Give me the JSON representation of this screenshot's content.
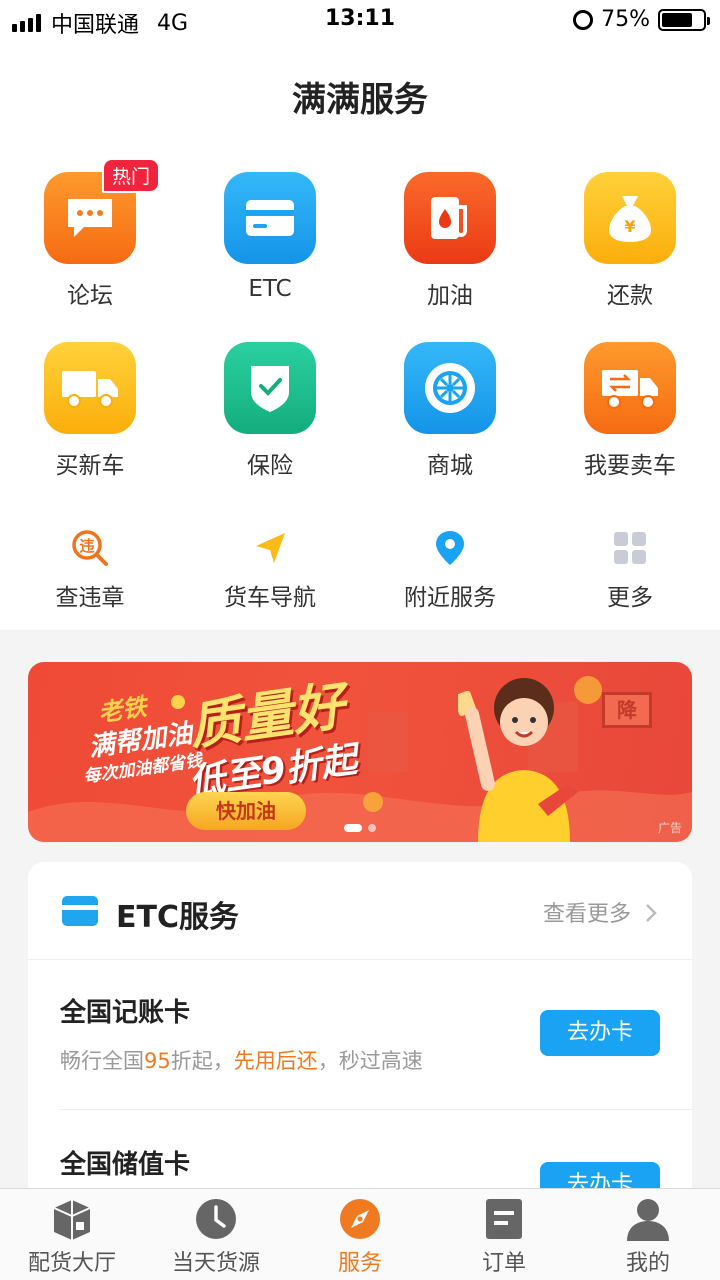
{
  "status_bar": {
    "carrier": "中国联通",
    "network": "4G",
    "time": "13:11",
    "battery_text": "75%",
    "battery_level": 0.75
  },
  "page": {
    "title": "满满服务"
  },
  "services_row1": [
    {
      "label": "论坛",
      "icon": "chat-icon",
      "color": "#f77c1b",
      "badge": "热门"
    },
    {
      "label": "ETC",
      "icon": "card-icon",
      "color": "#1da4f0"
    },
    {
      "label": "加油",
      "icon": "fuel-icon",
      "color": "#f04a1e"
    },
    {
      "label": "还款",
      "icon": "money-bag-icon",
      "color": "#fdb913"
    }
  ],
  "services_row2": [
    {
      "label": "买新车",
      "icon": "truck-icon",
      "color": "#fdbb17"
    },
    {
      "label": "保险",
      "icon": "shield-icon",
      "color": "#1fbf8f"
    },
    {
      "label": "商城",
      "icon": "wheel-icon",
      "color": "#1aa3f2"
    },
    {
      "label": "我要卖车",
      "icon": "sell-truck-icon",
      "color": "#f7751d"
    }
  ],
  "services_row3": [
    {
      "label": "查违章",
      "icon": "violation-search-icon",
      "color": "#f0731f"
    },
    {
      "label": "货车导航",
      "icon": "navigation-arrow-icon",
      "color": "#fdbb17"
    },
    {
      "label": "附近服务",
      "icon": "location-pin-icon",
      "color": "#1aa3f2"
    },
    {
      "label": "更多",
      "icon": "grid-more-icon",
      "color": "#c9cbd6"
    }
  ],
  "banner": {
    "tag": "老铁",
    "line1": "满帮加油",
    "line2": "每次加油都省钱",
    "headline": "质量好",
    "discount": "低至9折起",
    "button": "快加油",
    "sign": "降",
    "ad_label": "广告",
    "slide_index": 1,
    "slide_count": 2
  },
  "etc": {
    "title": "ETC服务",
    "more": "查看更多",
    "items": [
      {
        "name": "全国记账卡",
        "desc_parts": [
          "畅行全国",
          "95",
          "折起，",
          "先用后还",
          "，秒过高速"
        ],
        "button": "去办卡"
      },
      {
        "name": "全国储值卡",
        "button": "去办卡"
      }
    ]
  },
  "tab_bar": {
    "tabs": [
      {
        "label": "配货大厅",
        "icon": "cargo-box-icon"
      },
      {
        "label": "当天货源",
        "icon": "clock-icon"
      },
      {
        "label": "服务",
        "icon": "compass-icon",
        "active": true
      },
      {
        "label": "订单",
        "icon": "order-icon"
      },
      {
        "label": "我的",
        "icon": "profile-icon"
      }
    ]
  }
}
